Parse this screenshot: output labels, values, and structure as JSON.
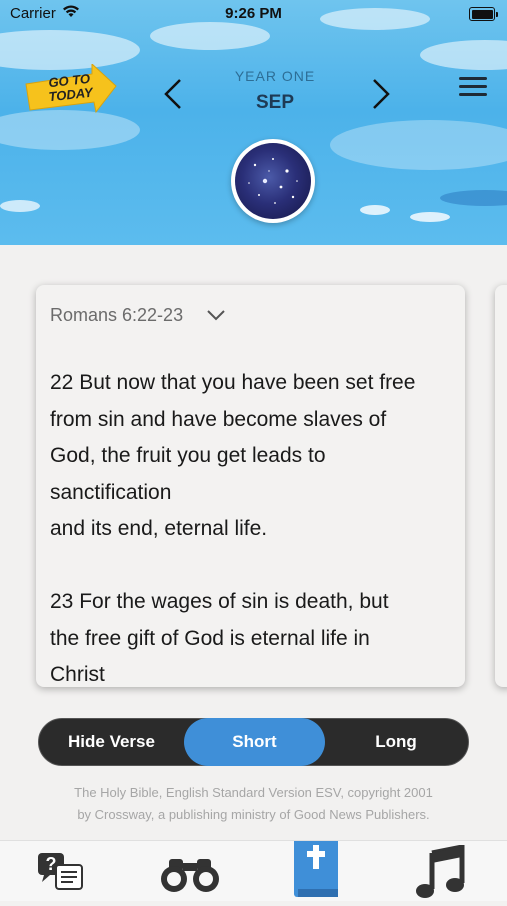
{
  "status_bar": {
    "carrier": "Carrier",
    "time": "9:26 PM"
  },
  "header": {
    "go_to_today_line1": "GO TO",
    "go_to_today_line2": "TODAY",
    "year_label": "YEAR ONE",
    "month_label": "SEP",
    "prev_icon": "chevron-left-icon",
    "next_icon": "chevron-right-icon",
    "menu_icon": "hamburger-menu-icon"
  },
  "card": {
    "reference": "Romans 6:22-23",
    "reference_icon": "chevron-down-icon",
    "verse_lines": [
      "22 But now that you have been set free",
      "from sin and have become slaves of",
      "God, the fruit you get leads to",
      "sanctification",
      "and its end, eternal life.",
      "",
      "23 For the wages of sin is death, but",
      "the free gift of God is eternal life in",
      "Christ"
    ]
  },
  "segment": {
    "options": [
      "Hide Verse",
      "Short",
      "Long"
    ],
    "selected": "Short",
    "active_color": "#3f8fd8",
    "background_color": "#2b2b2b"
  },
  "copyright": {
    "line1": "The Holy Bible, English Standard Version ESV, copyright 2001",
    "line2": "by Crossway, a publishing ministry of Good News Publishers."
  },
  "tab_bar": {
    "tabs": [
      {
        "icon": "question-chat-icon",
        "active": false
      },
      {
        "icon": "binoculars-icon",
        "active": false
      },
      {
        "icon": "bible-icon",
        "active": true
      },
      {
        "icon": "music-note-icon",
        "active": false
      }
    ],
    "active_color": "#3f8fd8",
    "icon_color": "#333333"
  },
  "colors": {
    "sky": "#4cb2ea",
    "badge_yellow": "#f6c21c"
  }
}
